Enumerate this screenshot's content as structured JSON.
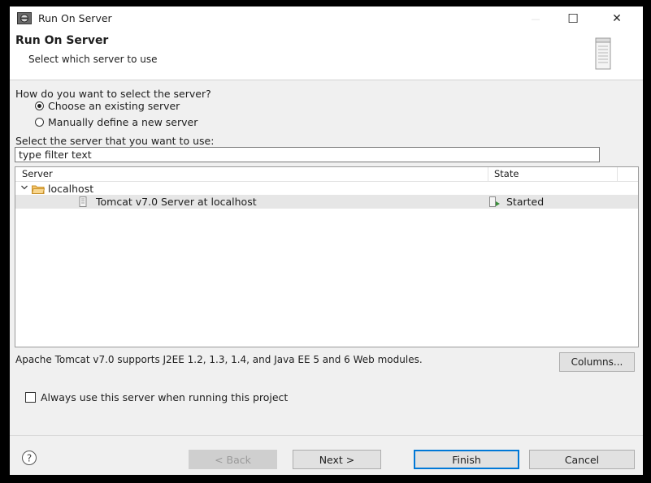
{
  "window": {
    "title": "Run On Server",
    "controls": {
      "minimize": "—",
      "maximize": "☐",
      "close": "✕"
    }
  },
  "header": {
    "title": "Run On Server",
    "subtitle": "Select which server to use",
    "icon": "server-tower-icon"
  },
  "selection": {
    "question": "How do you want to select the server?",
    "options": [
      {
        "label": "Choose an existing server",
        "checked": true
      },
      {
        "label": "Manually define a new server",
        "checked": false
      }
    ]
  },
  "filter": {
    "label": "Select the server that you want to use:",
    "value": "type filter text"
  },
  "server_table": {
    "columns": [
      "Server",
      "State"
    ],
    "nodes": [
      {
        "label": "localhost",
        "expanded": true,
        "icon": "folder-icon",
        "children": [
          {
            "name": "Tomcat v7.0 Server at localhost",
            "state": "Started",
            "icon": "server-icon",
            "state_icon": "started-icon",
            "selected": true
          }
        ]
      }
    ]
  },
  "description": "Apache Tomcat v7.0 supports J2EE 1.2, 1.3, 1.4, and Java EE 5 and 6 Web modules.",
  "buttons": {
    "columns": "Columns...",
    "help": "?",
    "back": "< Back",
    "next": "Next >",
    "finish": "Finish",
    "cancel": "Cancel"
  },
  "always_use": {
    "label": "Always use this server when running this project",
    "checked": false
  },
  "colors": {
    "window_bg": "#f0f0f0",
    "selection_row": "#e6e6e6",
    "default_button_border": "#0078d7",
    "state_green": "#3a8f3a"
  }
}
